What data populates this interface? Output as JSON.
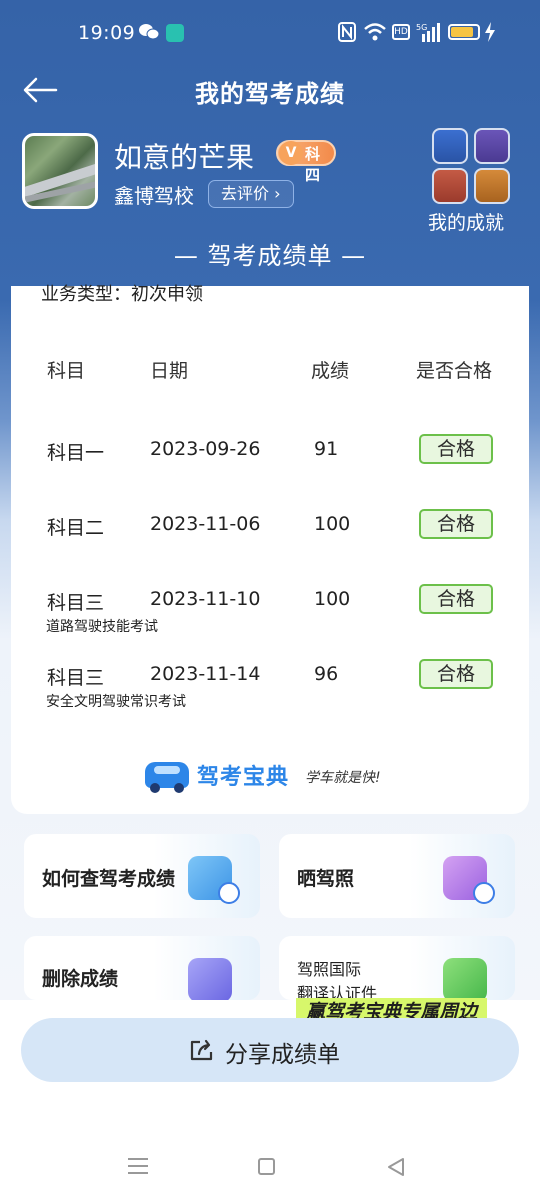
{
  "status_bar": {
    "time": "19:09",
    "hd_label": "HD",
    "signal_label": "5G"
  },
  "header": {
    "title": "我的驾考成绩"
  },
  "profile": {
    "username": "如意的芒果",
    "badge_v": "V",
    "badge_subject": "科四",
    "school": "鑫博驾校",
    "review_button": "去评价 ›"
  },
  "achievements": {
    "label": "我的成就"
  },
  "report": {
    "section_title": "— 驾考成绩单 —",
    "business_type": "业务类型：初次申领",
    "columns": [
      "科目",
      "日期",
      "成绩",
      "是否合格"
    ],
    "rows": [
      {
        "subject": "科目一",
        "date": "2023-09-26",
        "score": "91",
        "result": "合格",
        "note": ""
      },
      {
        "subject": "科目二",
        "date": "2023-11-06",
        "score": "100",
        "result": "合格",
        "note": ""
      },
      {
        "subject": "科目三",
        "date": "2023-11-10",
        "score": "100",
        "result": "合格",
        "note": "道路驾驶技能考试"
      },
      {
        "subject": "科目三",
        "date": "2023-11-14",
        "score": "96",
        "result": "合格",
        "note": "安全文明驾驶常识考试"
      }
    ],
    "brand_name": "驾考宝典",
    "brand_slogan": "学车就是快!"
  },
  "tiles": {
    "check_scores": "如何查驾考成绩",
    "show_license": "晒驾照",
    "delete_scores": "删除成绩",
    "license_intl_line1": "驾照国际",
    "license_intl_line2": "翻译认证件"
  },
  "promo": {
    "text": "赢驾考宝典专属周边"
  },
  "share": {
    "label": "分享成绩单"
  },
  "colors": {
    "header_blue": "#3563a8",
    "pass_green": "#6cc04a",
    "brand_blue": "#2d86e8",
    "promo_lime": "#d7f76b"
  }
}
